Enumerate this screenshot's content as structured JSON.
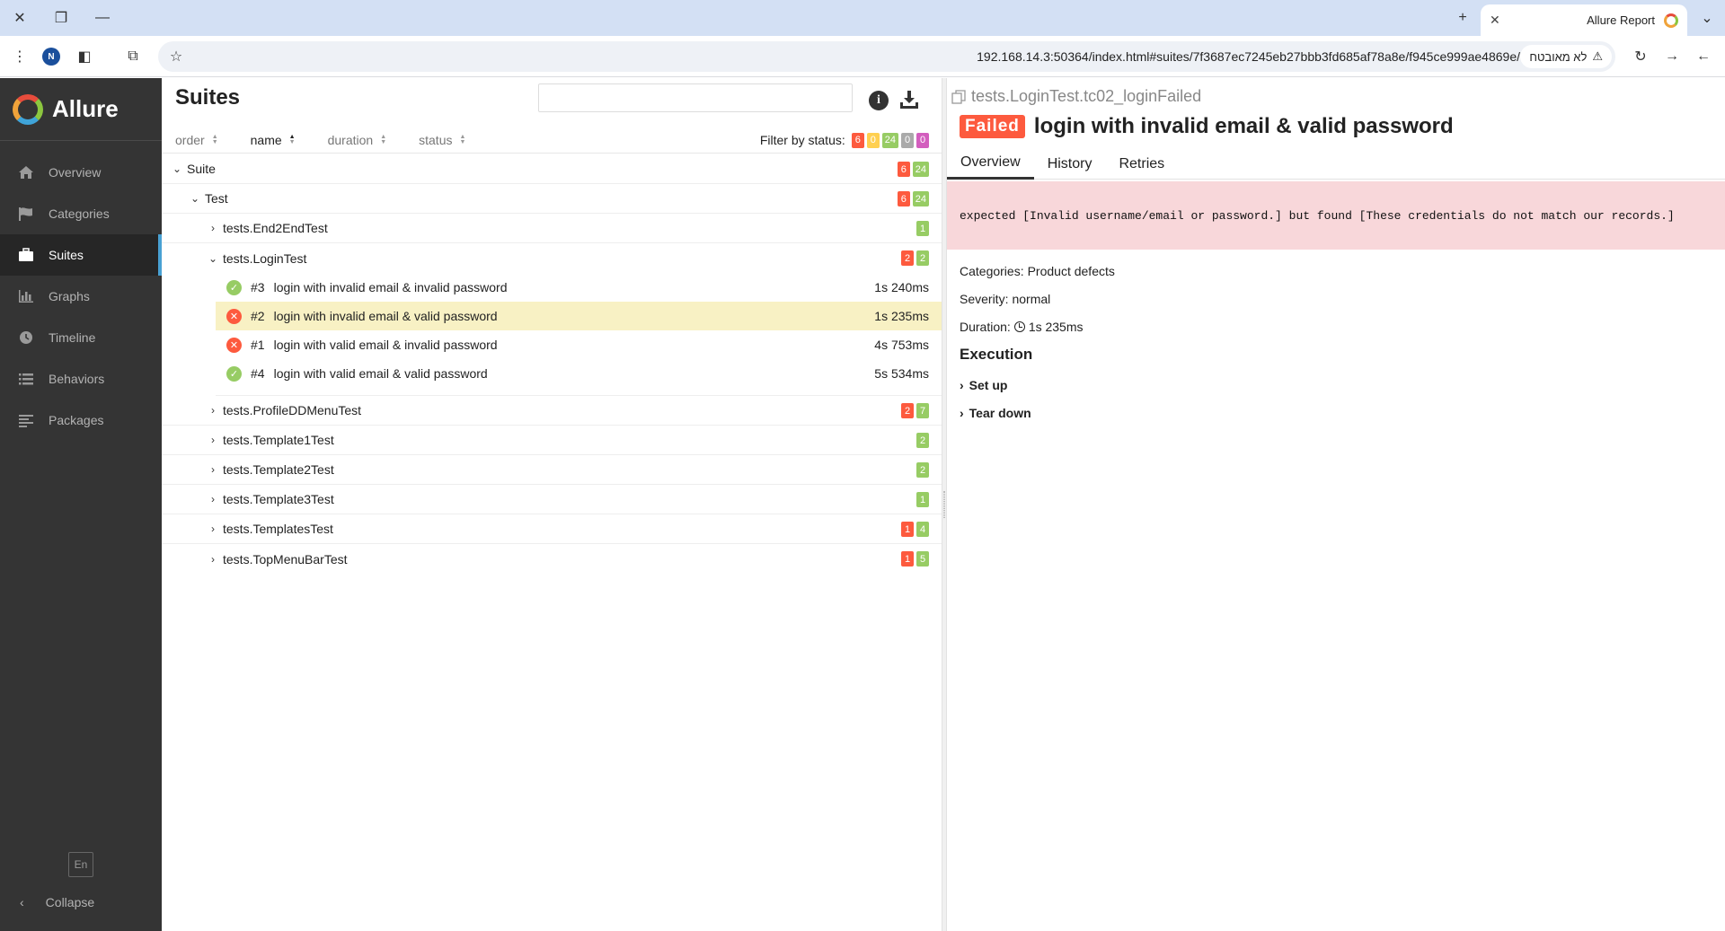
{
  "browser": {
    "tab_title": "Allure Report",
    "url": "192.168.14.3:50364/index.html#suites/7f3687ec7245eb27bbb3fd685af78a8e/f945ce999ae4869e/",
    "security_text": "לא מאובטח",
    "profile_initial": "N"
  },
  "sidebar": {
    "brand": "Allure",
    "items": [
      {
        "label": "Overview",
        "icon": "home-icon"
      },
      {
        "label": "Categories",
        "icon": "flag-icon"
      },
      {
        "label": "Suites",
        "icon": "briefcase-icon",
        "active": true
      },
      {
        "label": "Graphs",
        "icon": "bar-chart-icon"
      },
      {
        "label": "Timeline",
        "icon": "clock-icon"
      },
      {
        "label": "Behaviors",
        "icon": "list-icon"
      },
      {
        "label": "Packages",
        "icon": "align-left-icon"
      }
    ],
    "language": "En",
    "collapse_label": "Collapse"
  },
  "suites": {
    "title": "Suites",
    "search_placeholder": "",
    "sort": [
      {
        "label": "order"
      },
      {
        "label": "name",
        "active": true
      },
      {
        "label": "duration"
      },
      {
        "label": "status"
      }
    ],
    "filter_label": "Filter by status:",
    "filter_counts": {
      "failed": "6",
      "broken": "0",
      "passed": "24",
      "skipped": "0",
      "unknown": "0"
    },
    "tree": {
      "suite": {
        "label": "Suite",
        "failed": "6",
        "passed": "24"
      },
      "test": {
        "label": "Test",
        "failed": "6",
        "passed": "24"
      },
      "groups": [
        {
          "label": "tests.End2EndTest",
          "passed": "1"
        },
        {
          "label": "tests.LoginTest",
          "failed": "2",
          "passed": "2",
          "expanded": true
        },
        {
          "label": "tests.ProfileDDMenuTest",
          "failed": "2",
          "passed": "7"
        },
        {
          "label": "tests.Template1Test",
          "passed": "2"
        },
        {
          "label": "tests.Template2Test",
          "passed": "2"
        },
        {
          "label": "tests.Template3Test",
          "passed": "1"
        },
        {
          "label": "tests.TemplatesTest",
          "failed": "1",
          "passed": "4"
        },
        {
          "label": "tests.TopMenuBarTest",
          "failed": "1",
          "passed": "5"
        }
      ],
      "cases": [
        {
          "num": "#3",
          "name": "login with invalid email & invalid password",
          "duration": "1s 240ms",
          "status": "passed"
        },
        {
          "num": "#2",
          "name": "login with invalid email & valid password",
          "duration": "1s 235ms",
          "status": "failed",
          "selected": true
        },
        {
          "num": "#1",
          "name": "login with valid email & invalid password",
          "duration": "4s 753ms",
          "status": "failed"
        },
        {
          "num": "#4",
          "name": "login with valid email & valid password",
          "duration": "5s 534ms",
          "status": "passed"
        }
      ]
    }
  },
  "detail": {
    "full_name": "tests.LoginTest.tc02_loginFailed",
    "status": "Failed",
    "title": "login with invalid email & valid password",
    "tabs": [
      "Overview",
      "History",
      "Retries"
    ],
    "error_message": "expected [Invalid username/email or password.] but found [These credentials do not match our records.]",
    "categories_label": "Categories:",
    "categories_value": "Product defects",
    "severity_label": "Severity:",
    "severity_value": "normal",
    "duration_label": "Duration:",
    "duration_value": "1s 235ms",
    "execution_title": "Execution",
    "execution_items": [
      "Set up",
      "Tear down"
    ]
  },
  "colors": {
    "failed": "#fd5a3e",
    "broken": "#ffd050",
    "passed": "#97cc64",
    "skipped": "#aaaaaa",
    "unknown": "#d35ebe",
    "sidebar_bg": "#343434",
    "selected_row": "#f8f1c4",
    "error_bg": "#f8d7da"
  }
}
